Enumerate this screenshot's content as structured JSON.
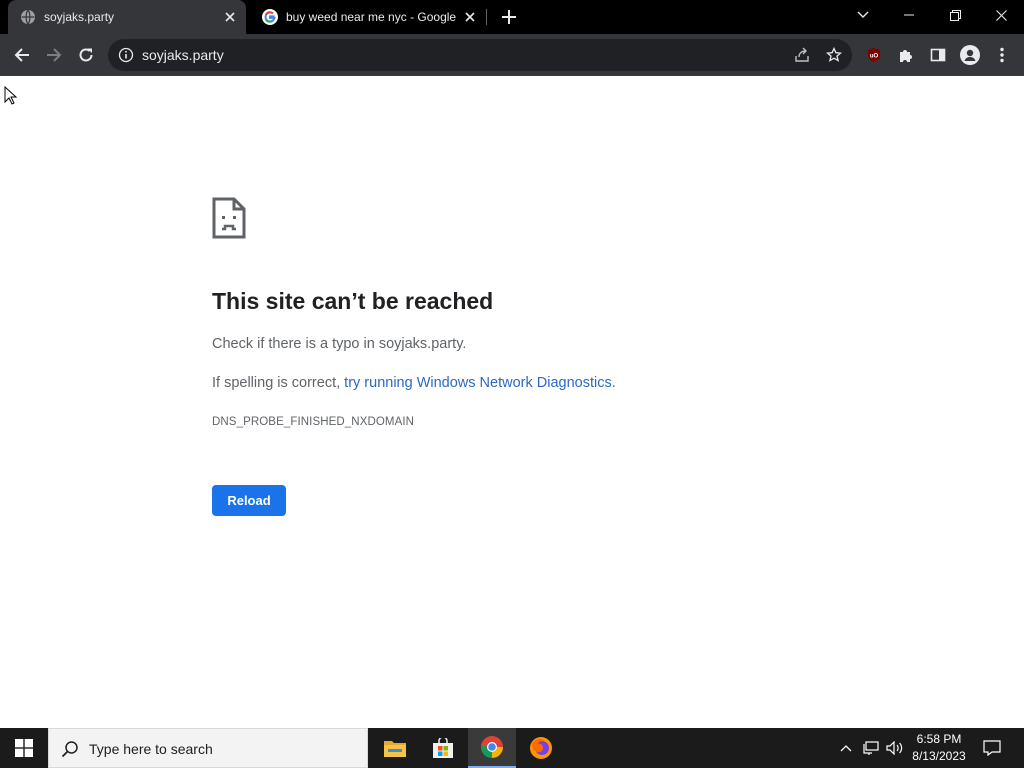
{
  "browser": {
    "tabs": [
      {
        "title": "soyjaks.party",
        "active": true
      },
      {
        "title": "buy weed near me nyc - Google",
        "active": false
      }
    ],
    "address_bar": {
      "url": "soyjaks.party"
    },
    "colors": {
      "frame": "#000000",
      "toolbar": "#35363a",
      "omnibox": "#202124",
      "text": "#e8eaed"
    }
  },
  "error_page": {
    "icon": "sad-page-icon",
    "title": "This site can’t be reached",
    "line1": "Check if there is a typo in soyjaks.party.",
    "line2_prefix": "If spelling is correct, ",
    "line2_link": "try running Windows Network Diagnostics.",
    "error_code": "DNS_PROBE_FINISHED_NXDOMAIN",
    "reload_label": "Reload",
    "colors": {
      "title": "#202124",
      "body": "#5f6368",
      "link": "#2d68c4",
      "button": "#1a73e8"
    }
  },
  "taskbar": {
    "search_placeholder": "Type here to search",
    "apps": [
      "file-explorer-icon",
      "microsoft-store-icon",
      "chrome-icon",
      "firefox-icon"
    ],
    "time": "6:58 PM",
    "date": "8/13/2023"
  }
}
